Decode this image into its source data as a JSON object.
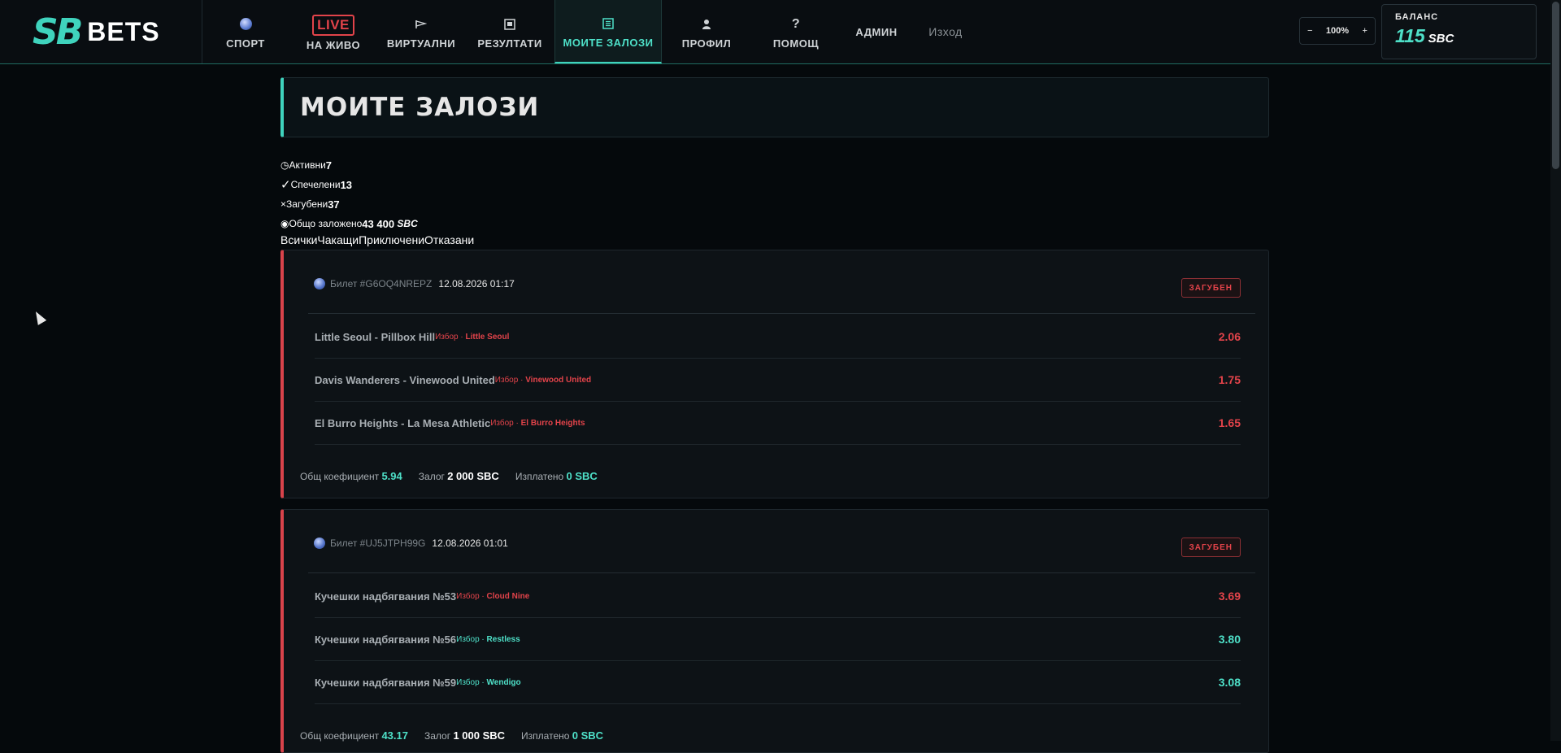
{
  "header": {
    "logo_sb": "SB",
    "logo_bets": "BETS",
    "nav": [
      {
        "label": "СПОРТ",
        "icon": "globe-icon"
      },
      {
        "label": "НА ЖИВО",
        "icon_text": "LIVE"
      },
      {
        "label": "ВИРТУАЛНИ",
        "icon": "flag-icon"
      },
      {
        "label": "РЕЗУЛТАТИ",
        "icon": "results-icon"
      },
      {
        "label": "МОИТЕ ЗАЛОЗИ",
        "icon": "list-icon",
        "active": true
      },
      {
        "label": "ПРОФИЛ",
        "icon": "user-icon"
      },
      {
        "label": "ПОМОЩ",
        "icon": "help-icon"
      },
      {
        "label": "АДМИН"
      },
      {
        "label": "Изход"
      }
    ],
    "zoom": {
      "minus": "−",
      "value": "100%",
      "plus": "+"
    },
    "balance": {
      "label": "БАЛАНС",
      "amount": "115",
      "currency": "SBC"
    }
  },
  "page": {
    "title": "МОИТЕ ЗАЛОЗИ",
    "stats": [
      {
        "icon": "clock-icon",
        "glyph": "◷",
        "label": "Активни",
        "value": "7"
      },
      {
        "icon": "check-icon",
        "glyph": "✓",
        "label": "Спечелени",
        "value": "13"
      },
      {
        "icon": "cross-icon",
        "glyph": "×",
        "label": "Загубени",
        "value": "37"
      },
      {
        "icon": "coin-icon",
        "glyph": "◉",
        "label": "Общо заложено",
        "value": "43 400",
        "unit": "SBC"
      }
    ],
    "filters": [
      "Всички",
      "Чакащи",
      "Приключени",
      "Отказани"
    ]
  },
  "tickets": [
    {
      "id_label": "Билет #G6OQ4NREPZ",
      "datetime": "12.08.2026 01:17",
      "status": "ЗАГУБЕН",
      "selections": [
        {
          "event": "Little Seoul - Pillbox Hill",
          "pick_prefix": "Избор · ",
          "pick": "Little Seoul",
          "odd": "2.06",
          "won": false
        },
        {
          "event": "Davis Wanderers - Vinewood United",
          "pick_prefix": "Избор · ",
          "pick": "Vinewood United",
          "odd": "1.75",
          "won": false
        },
        {
          "event": "El Burro Heights - La Mesa Athletic",
          "pick_prefix": "Избор · ",
          "pick": "El Burro Heights",
          "odd": "1.65",
          "won": false
        }
      ],
      "footer": {
        "odds_label": "Общ коефициент",
        "odds": "5.94",
        "stake_label": "Залог",
        "stake": "2 000 SBC",
        "payout_label": "Изплатено",
        "payout": "0 SBC"
      }
    },
    {
      "id_label": "Билет #UJ5JTPH99G",
      "datetime": "12.08.2026 01:01",
      "status": "ЗАГУБЕН",
      "selections": [
        {
          "event": "Кучешки надбягвания №53",
          "pick_prefix": "Избор · ",
          "pick": "Cloud Nine",
          "odd": "3.69",
          "won": false
        },
        {
          "event": "Кучешки надбягвания №56",
          "pick_prefix": "Избор · ",
          "pick": "Restless",
          "odd": "3.80",
          "won": true
        },
        {
          "event": "Кучешки надбягвания №59",
          "pick_prefix": "Избор · ",
          "pick": "Wendigo",
          "odd": "3.08",
          "won": true
        }
      ],
      "footer": {
        "odds_label": "Общ коефициент",
        "odds": "43.17",
        "stake_label": "Залог",
        "stake": "1 000 SBC",
        "payout_label": "Изплатено",
        "payout": "0 SBC"
      }
    }
  ],
  "colors": {
    "accent": "#3fd3bd",
    "loss": "#e2434a",
    "bg": "#05090c"
  }
}
